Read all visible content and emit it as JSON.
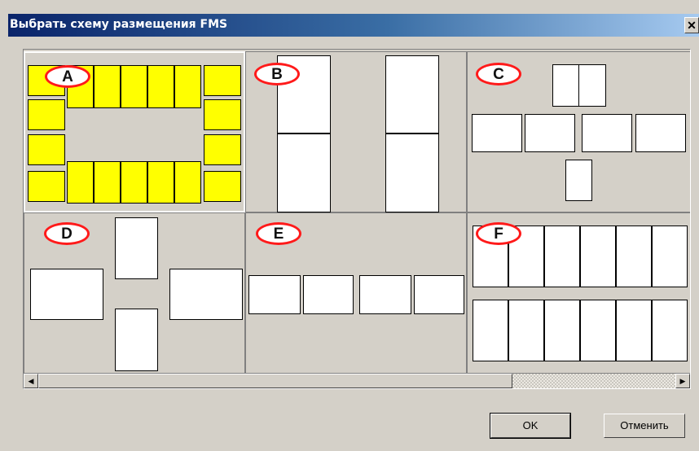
{
  "window": {
    "title": "Выбрать схему размещения FMS",
    "close_glyph": "✕"
  },
  "layouts": [
    {
      "label": "A",
      "selected": true
    },
    {
      "label": "B",
      "selected": false
    },
    {
      "label": "C",
      "selected": false
    },
    {
      "label": "D",
      "selected": false
    },
    {
      "label": "E",
      "selected": false
    },
    {
      "label": "F",
      "selected": false
    }
  ],
  "scrollbar": {
    "left_arrow": "◀",
    "right_arrow": "▶"
  },
  "buttons": {
    "ok": "OK",
    "cancel": "Отменить"
  },
  "colors": {
    "highlight": "#ffff00",
    "label_ring": "#ff1a1a",
    "title_start": "#0a246a",
    "title_end": "#a6caf0"
  }
}
